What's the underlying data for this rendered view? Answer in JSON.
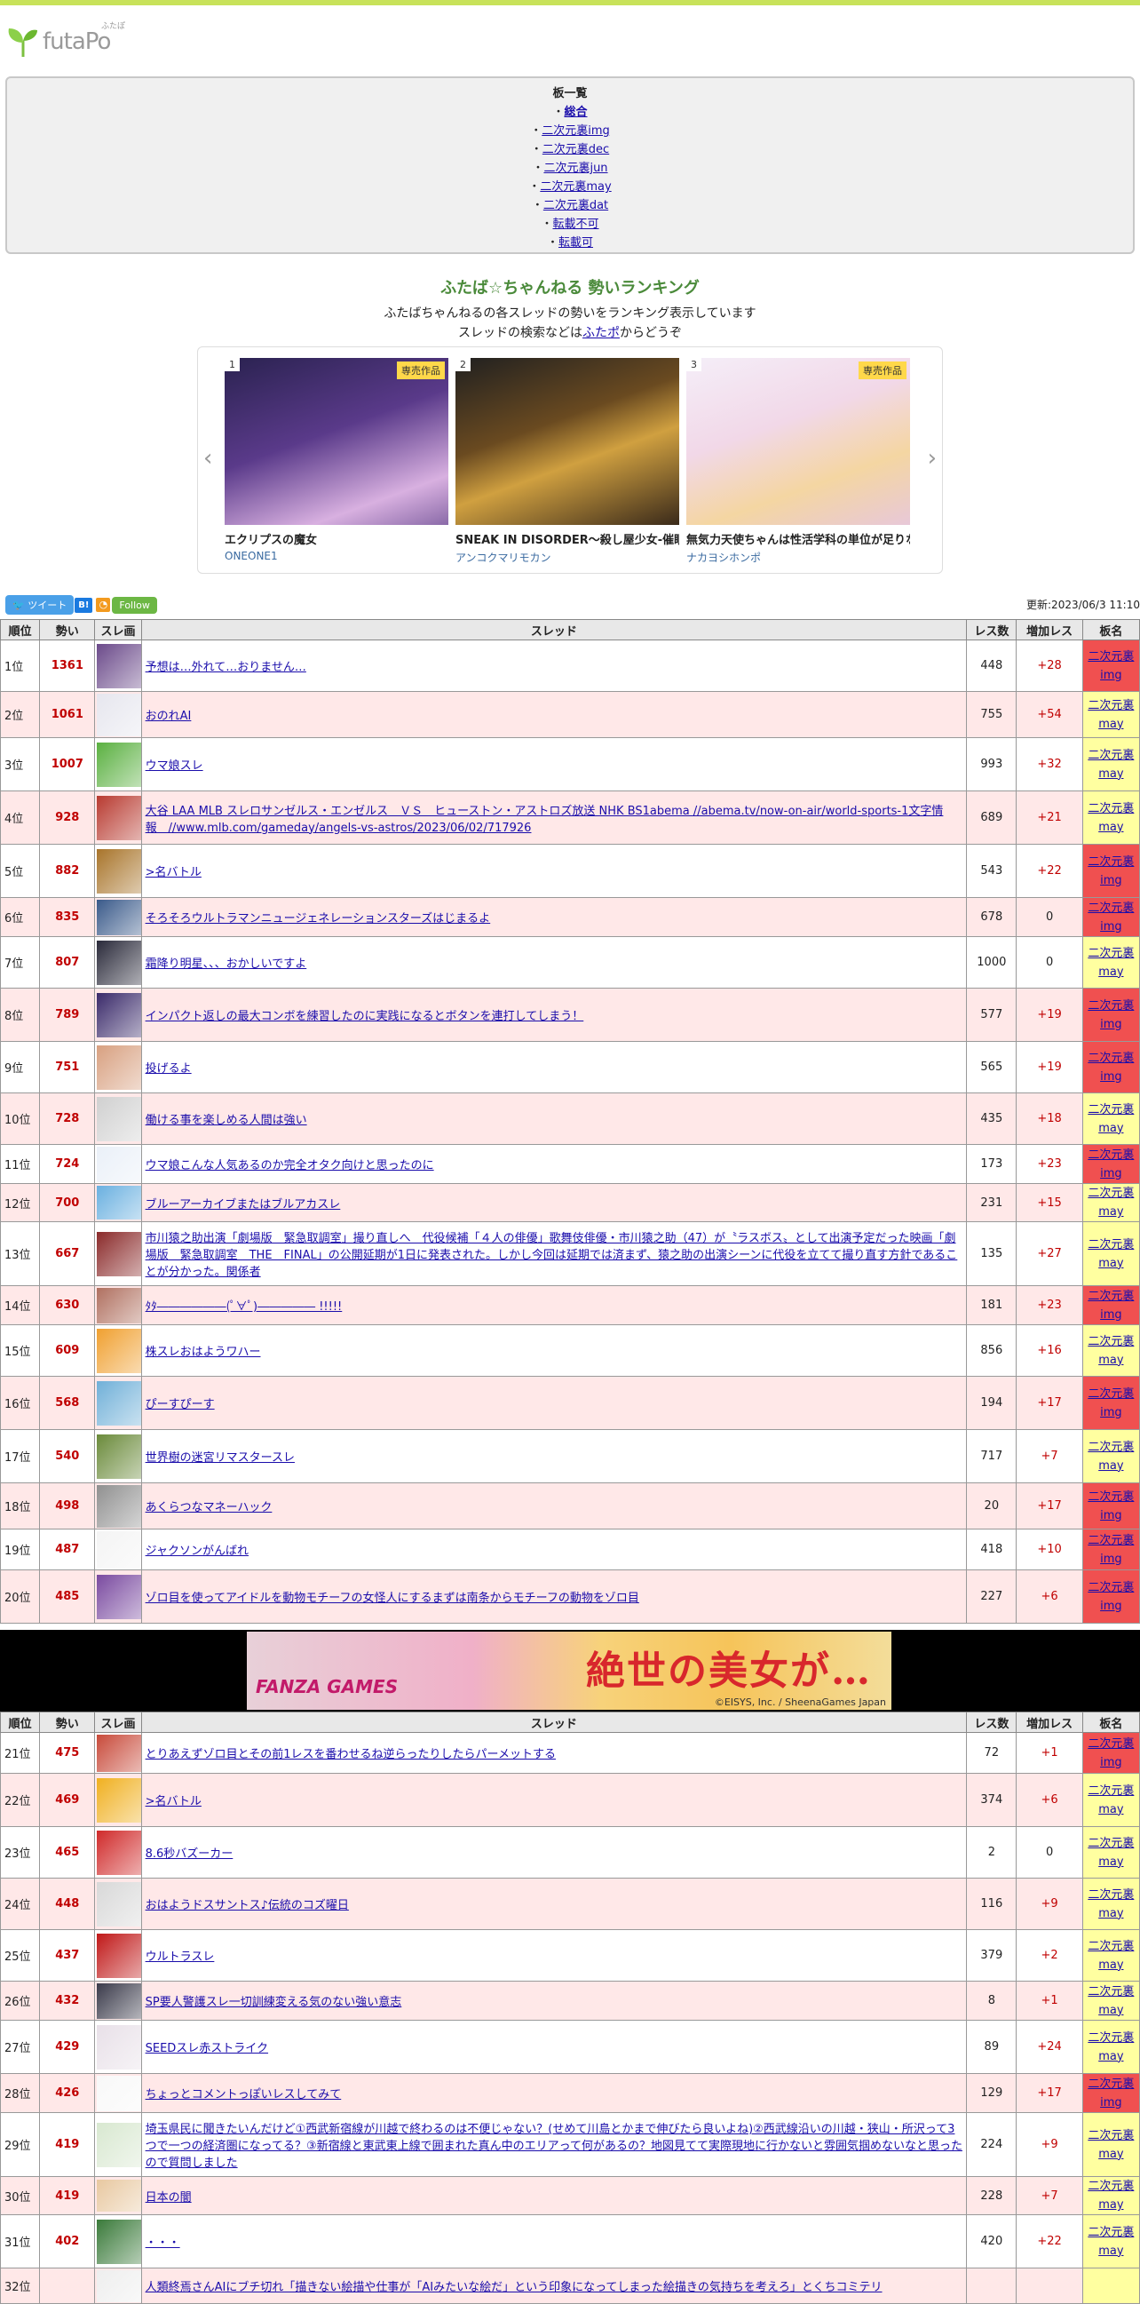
{
  "logo": {
    "text": "futaPo",
    "ruby": "ふたぽ"
  },
  "boards": {
    "title": "板一覧",
    "items": [
      {
        "label": "総合",
        "bold": true
      },
      {
        "label": "二次元裏img"
      },
      {
        "label": "二次元裏dec"
      },
      {
        "label": "二次元裏jun"
      },
      {
        "label": "二次元裏may"
      },
      {
        "label": "二次元裏dat"
      },
      {
        "label": "転載不可"
      },
      {
        "label": "転載可"
      }
    ]
  },
  "heading": {
    "title": "ふたば☆ちゃんねる 勢いランキング",
    "line1": "ふたばちゃんねるの各スレッドの勢いをランキング表示しています",
    "line2_pre": "スレッドの検索などは",
    "line2_link": "ふたポ",
    "line2_post": "からどうぞ"
  },
  "carousel": {
    "tag": "専売作品",
    "cards": [
      {
        "num": "1",
        "title": "エクリプスの魔女",
        "sub": "ONEONE1",
        "tag": "専売作品",
        "c1": "#3b2f6e",
        "c2": "#c9a1d8"
      },
      {
        "num": "2",
        "title": "SNEAK IN DISORDER～殺し屋少女-催眠",
        "sub": "アンコクマリモカン",
        "tag": "",
        "c1": "#1d1d1d",
        "c2": "#c8a040"
      },
      {
        "num": "3",
        "title": "無気力天使ちゃんは性活学科の単位が足りない",
        "sub": "ナカヨシホンポ",
        "tag": "専売作品",
        "c1": "#f0e8f4",
        "c2": "#f4d6a2"
      }
    ]
  },
  "social": {
    "tweet": "ツイート",
    "hatena": "B!",
    "follow": "Follow"
  },
  "updated": "更新:2023/06/3 11:10",
  "table_headers": {
    "pos": "順位",
    "score": "勢い",
    "thumb": "スレ画",
    "thread": "スレッド",
    "res": "レス数",
    "inc": "増加レス",
    "board": "板名"
  },
  "rows1": [
    {
      "pos": "1位",
      "score": "1361",
      "title": "予想は…外れて…おりません…",
      "res": "448",
      "inc": "+28",
      "board": [
        "二次元裏",
        "img"
      ],
      "bt": "img",
      "h": 58,
      "c": "#6b4a8a"
    },
    {
      "pos": "2位",
      "score": "1061",
      "title": "おのれAI",
      "res": "755",
      "inc": "+54",
      "board": [
        "二次元裏",
        "may"
      ],
      "bt": "may",
      "h": 52,
      "c": "#e6e6ee"
    },
    {
      "pos": "3位",
      "score": "1007",
      "title": "ウマ娘スレ",
      "res": "993",
      "inc": "+32",
      "board": [
        "二次元裏",
        "may"
      ],
      "bt": "may",
      "h": 60,
      "c": "#5ab040"
    },
    {
      "pos": "4位",
      "score": "928",
      "title": "大谷 LAA MLB スレロサンゼルス・エンゼルス　ＶＳ　ヒューストン・アストロズ放送 NHK BS1abema //abema.tv/now-on-air/world-sports-1文字情報　//www.mlb.com/gameday/angels-vs-astros/2023/06/02/717926",
      "res": "689",
      "inc": "+21",
      "board": [
        "二次元裏",
        "may"
      ],
      "bt": "may",
      "h": 60,
      "c": "#b83a30"
    },
    {
      "pos": "5位",
      "score": "882",
      "title": ">名バトル",
      "res": "543",
      "inc": "+22",
      "board": [
        "二次元裏",
        "img"
      ],
      "bt": "img",
      "h": 60,
      "c": "#a8742a"
    },
    {
      "pos": "6位",
      "score": "835",
      "title": "そろそろウルトラマンニュージェネレーションスターズはじまるよ",
      "res": "678",
      "inc": "0",
      "board": [
        "二次元裏",
        "img"
      ],
      "bt": "img",
      "h": 44,
      "c": "#3a5a8a"
    },
    {
      "pos": "7位",
      "score": "807",
      "title": "霜降り明星、、、おかしいですよ",
      "res": "1000",
      "inc": "0",
      "board": [
        "二次元裏",
        "may"
      ],
      "bt": "may",
      "h": 58,
      "c": "#2a2a3a"
    },
    {
      "pos": "8位",
      "score": "789",
      "title": "インパクト返しの最大コンボを練習したのに実践になるとボタンを連打してしまう！",
      "res": "577",
      "inc": "+19",
      "board": [
        "二次元裏",
        "img"
      ],
      "bt": "img",
      "h": 60,
      "c": "#3a2a6a"
    },
    {
      "pos": "9位",
      "score": "751",
      "title": "投げるよ",
      "res": "565",
      "inc": "+19",
      "board": [
        "二次元裏",
        "img"
      ],
      "bt": "img",
      "h": 58,
      "c": "#d8a080"
    },
    {
      "pos": "10位",
      "score": "728",
      "title": "働ける事を楽しめる人間は強い",
      "res": "435",
      "inc": "+18",
      "board": [
        "二次元裏",
        "may"
      ],
      "bt": "may",
      "h": 58,
      "c": "#d0d0d0"
    },
    {
      "pos": "11位",
      "score": "724",
      "title": "ウマ娘こんな人気あるのか完全オタク向けと思ったのに",
      "res": "173",
      "inc": "+23",
      "board": [
        "二次元裏",
        "img"
      ],
      "bt": "img",
      "h": 44,
      "c": "#eaf0f8"
    },
    {
      "pos": "12位",
      "score": "700",
      "title": "ブルーアーカイブまたはブルアカスレ",
      "res": "231",
      "inc": "+15",
      "board": [
        "二次元裏",
        "may"
      ],
      "bt": "may",
      "h": 42,
      "c": "#6ab0e0"
    },
    {
      "pos": "13位",
      "score": "667",
      "title": "市川猿之助出演「劇場版　緊急取調室」撮り直しへ　代役候補「４人の俳優」歌舞伎俳優・市川猿之助（47）が〝ラスボス〟として出演予定だった映画「劇場版　緊急取調室　THE　FINAL」の公開延期が1日に発表された。しかし今回は延期では済まず、猿之助の出演シーンに代役を立てて撮り直す方針であることが分かった。関係者",
      "res": "135",
      "inc": "+27",
      "board": [
        "二次元裏",
        "may"
      ],
      "bt": "may",
      "h": 72,
      "c": "#8a2a2a"
    },
    {
      "pos": "14位",
      "score": "630",
      "title": "ﾀﾀ――――――(ﾟ∀ﾟ)――――― !!!!!",
      "res": "181",
      "inc": "+23",
      "board": [
        "二次元裏",
        "img"
      ],
      "bt": "img",
      "h": 44,
      "c": "#b07060"
    },
    {
      "pos": "15位",
      "score": "609",
      "title": "株スレおはようワハー",
      "res": "856",
      "inc": "+16",
      "board": [
        "二次元裏",
        "may"
      ],
      "bt": "may",
      "h": 58,
      "c": "#f0a030"
    },
    {
      "pos": "16位",
      "score": "568",
      "title": "ぴーすぴーす",
      "res": "194",
      "inc": "+17",
      "board": [
        "二次元裏",
        "img"
      ],
      "bt": "img",
      "h": 60,
      "c": "#70b0d8"
    },
    {
      "pos": "17位",
      "score": "540",
      "title": "世界樹の迷宮リマスタースレ",
      "res": "717",
      "inc": "+7",
      "board": [
        "二次元裏",
        "may"
      ],
      "bt": "may",
      "h": 60,
      "c": "#6a8a3a"
    },
    {
      "pos": "18位",
      "score": "498",
      "title": "あくらつなマネーハック",
      "res": "20",
      "inc": "+17",
      "board": [
        "二次元裏",
        "img"
      ],
      "bt": "img",
      "h": 52,
      "c": "#909090"
    },
    {
      "pos": "19位",
      "score": "487",
      "title": "ジャクソンがんばれ",
      "res": "418",
      "inc": "+10",
      "board": [
        "二次元裏",
        "img"
      ],
      "bt": "img",
      "h": 46,
      "c": "#f4f4f4"
    },
    {
      "pos": "20位",
      "score": "485",
      "title": "ゾロ目を使ってアイドルを動物モチーフの女怪人にするまずは南条からモチーフの動物をゾロ目",
      "res": "227",
      "inc": "+6",
      "board": [
        "二次元裏",
        "img"
      ],
      "bt": "img",
      "h": 60,
      "c": "#7a4aa0"
    }
  ],
  "ad": {
    "brand": "FANZA GAMES",
    "title": "絶世の美女が…",
    "copyright": "©EISYS, Inc. / SheenaGames Japan"
  },
  "rows2": [
    {
      "pos": "21位",
      "score": "475",
      "title": "とりあえずゾロ目とその前1レスを番わせるね逆らったりしたらパーメットする",
      "res": "72",
      "inc": "+1",
      "board": [
        "二次元裏",
        "img"
      ],
      "bt": "img",
      "h": 46,
      "c": "#c84a3a"
    },
    {
      "pos": "22位",
      "score": "469",
      "title": ">名バトル",
      "res": "374",
      "inc": "+6",
      "board": [
        "二次元裏",
        "may"
      ],
      "bt": "may",
      "h": 60,
      "c": "#f0b020"
    },
    {
      "pos": "23位",
      "score": "465",
      "title": "8.6秒バズーカー",
      "res": "2",
      "inc": "0",
      "board": [
        "二次元裏",
        "may"
      ],
      "bt": "may",
      "h": 58,
      "c": "#d02a2a"
    },
    {
      "pos": "24位",
      "score": "448",
      "title": "おはようドスサントス♪伝統のコズ曜日",
      "res": "116",
      "inc": "+9",
      "board": [
        "二次元裏",
        "may"
      ],
      "bt": "may",
      "h": 58,
      "c": "#d8d8d8"
    },
    {
      "pos": "25位",
      "score": "437",
      "title": "ウルトラスレ",
      "res": "379",
      "inc": "+2",
      "board": [
        "二次元裏",
        "may"
      ],
      "bt": "may",
      "h": 58,
      "c": "#c01818"
    },
    {
      "pos": "26位",
      "score": "432",
      "title": "SP要人警護スレ一切訓練変える気のない強い意志",
      "res": "8",
      "inc": "+1",
      "board": [
        "二次元裏",
        "may"
      ],
      "bt": "may",
      "h": 44,
      "c": "#3a3a4a"
    },
    {
      "pos": "27位",
      "score": "429",
      "title": "SEEDスレ赤ストライク",
      "res": "89",
      "inc": "+24",
      "board": [
        "二次元裏",
        "may"
      ],
      "bt": "may",
      "h": 60,
      "c": "#e8e0e8"
    },
    {
      "pos": "28位",
      "score": "426",
      "title": "ちょっとコメントっぽいレスしてみて",
      "res": "129",
      "inc": "+17",
      "board": [
        "二次元裏",
        "img"
      ],
      "bt": "img",
      "h": 44,
      "c": "#f8f8f8"
    },
    {
      "pos": "29位",
      "score": "419",
      "title": "埼玉県民に聞きたいんだけど①西武新宿線が川越で終わるのは不便じゃない？(せめて川島とかまで伸びたら良いよね)②西武線沿いの川越・狭山・所沢って3つで一つの経済圏になってる？③新宿線と東武東上線で囲まれた真ん中のエリアって何があるの？地図見てて実際現地に行かないと雰囲気掴めないなと思ったので質問しました",
      "res": "224",
      "inc": "+9",
      "board": [
        "二次元裏",
        "may"
      ],
      "bt": "may",
      "h": 72,
      "c": "#d8e8d0"
    },
    {
      "pos": "30位",
      "score": "419",
      "title": "日本の闇",
      "res": "228",
      "inc": "+7",
      "board": [
        "二次元裏",
        "may"
      ],
      "bt": "may",
      "h": 40,
      "c": "#e8c8a0"
    },
    {
      "pos": "31位",
      "score": "402",
      "title": "・・・",
      "res": "420",
      "inc": "+22",
      "board": [
        "二次元裏",
        "may"
      ],
      "bt": "may",
      "h": 60,
      "c": "#3a7a3a"
    },
    {
      "pos": "32位",
      "score": "",
      "title": "人類終焉さんAIにブチ切れ「描きない絵描や仕事が「AIみたいな絵だ」という印象になってしまった絵描きの気持ちを考えろ」とくちコミテリ",
      "res": "",
      "inc": "",
      "board": [
        "",
        ""
      ],
      "bt": "may",
      "h": 40,
      "c": "#eeeeee"
    }
  ]
}
